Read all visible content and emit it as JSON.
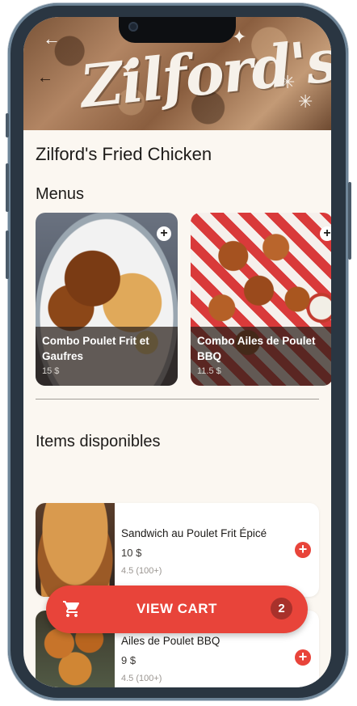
{
  "restaurant": {
    "banner_logo_text": "Zilford's",
    "name": "Zilford's Fried Chicken"
  },
  "nav": {
    "back_icon": "arrow-left-icon",
    "back_glyph": "←"
  },
  "menus": {
    "heading": "Menus",
    "items": [
      {
        "name": "Combo Poulet Frit et Gaufres",
        "price": "15 $",
        "add_glyph": "+"
      },
      {
        "name": "Combo Ailes de Poulet BBQ",
        "price": "11.5 $",
        "add_glyph": "+"
      }
    ]
  },
  "items_section": {
    "heading": "Items disponibles",
    "items": [
      {
        "name": "Sandwich au Poulet Frit Épicé",
        "price": "10 $",
        "rating": "4.5 (100+)",
        "add_glyph": "+"
      },
      {
        "name": "Ailes de Poulet BBQ",
        "price": "9 $",
        "rating": "4.5 (100+)",
        "add_glyph": "+"
      }
    ]
  },
  "cart": {
    "label": "VIEW CART",
    "count": "2",
    "icon": "shopping-cart-icon"
  },
  "colors": {
    "accent": "#e8443a",
    "background": "#fbf7f1"
  }
}
